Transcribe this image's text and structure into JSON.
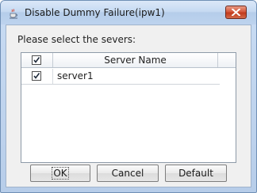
{
  "window": {
    "title": "Disable Dummy Failure(ipw1)"
  },
  "dialog": {
    "prompt": "Please select the severs:"
  },
  "table": {
    "columns": [
      "",
      "Server Name"
    ],
    "header_checked": true,
    "rows": [
      {
        "checked": true,
        "server_name": "server1"
      }
    ]
  },
  "buttons": {
    "ok": "OK",
    "cancel": "Cancel",
    "default": "Default"
  },
  "icons": {
    "app": "java-cup-icon",
    "close": "close-icon",
    "check": "checkmark-icon"
  },
  "colors": {
    "close_button": "#c94a2c",
    "client_bg": "#f0f0f0",
    "titlebar": "#c6daf2"
  }
}
